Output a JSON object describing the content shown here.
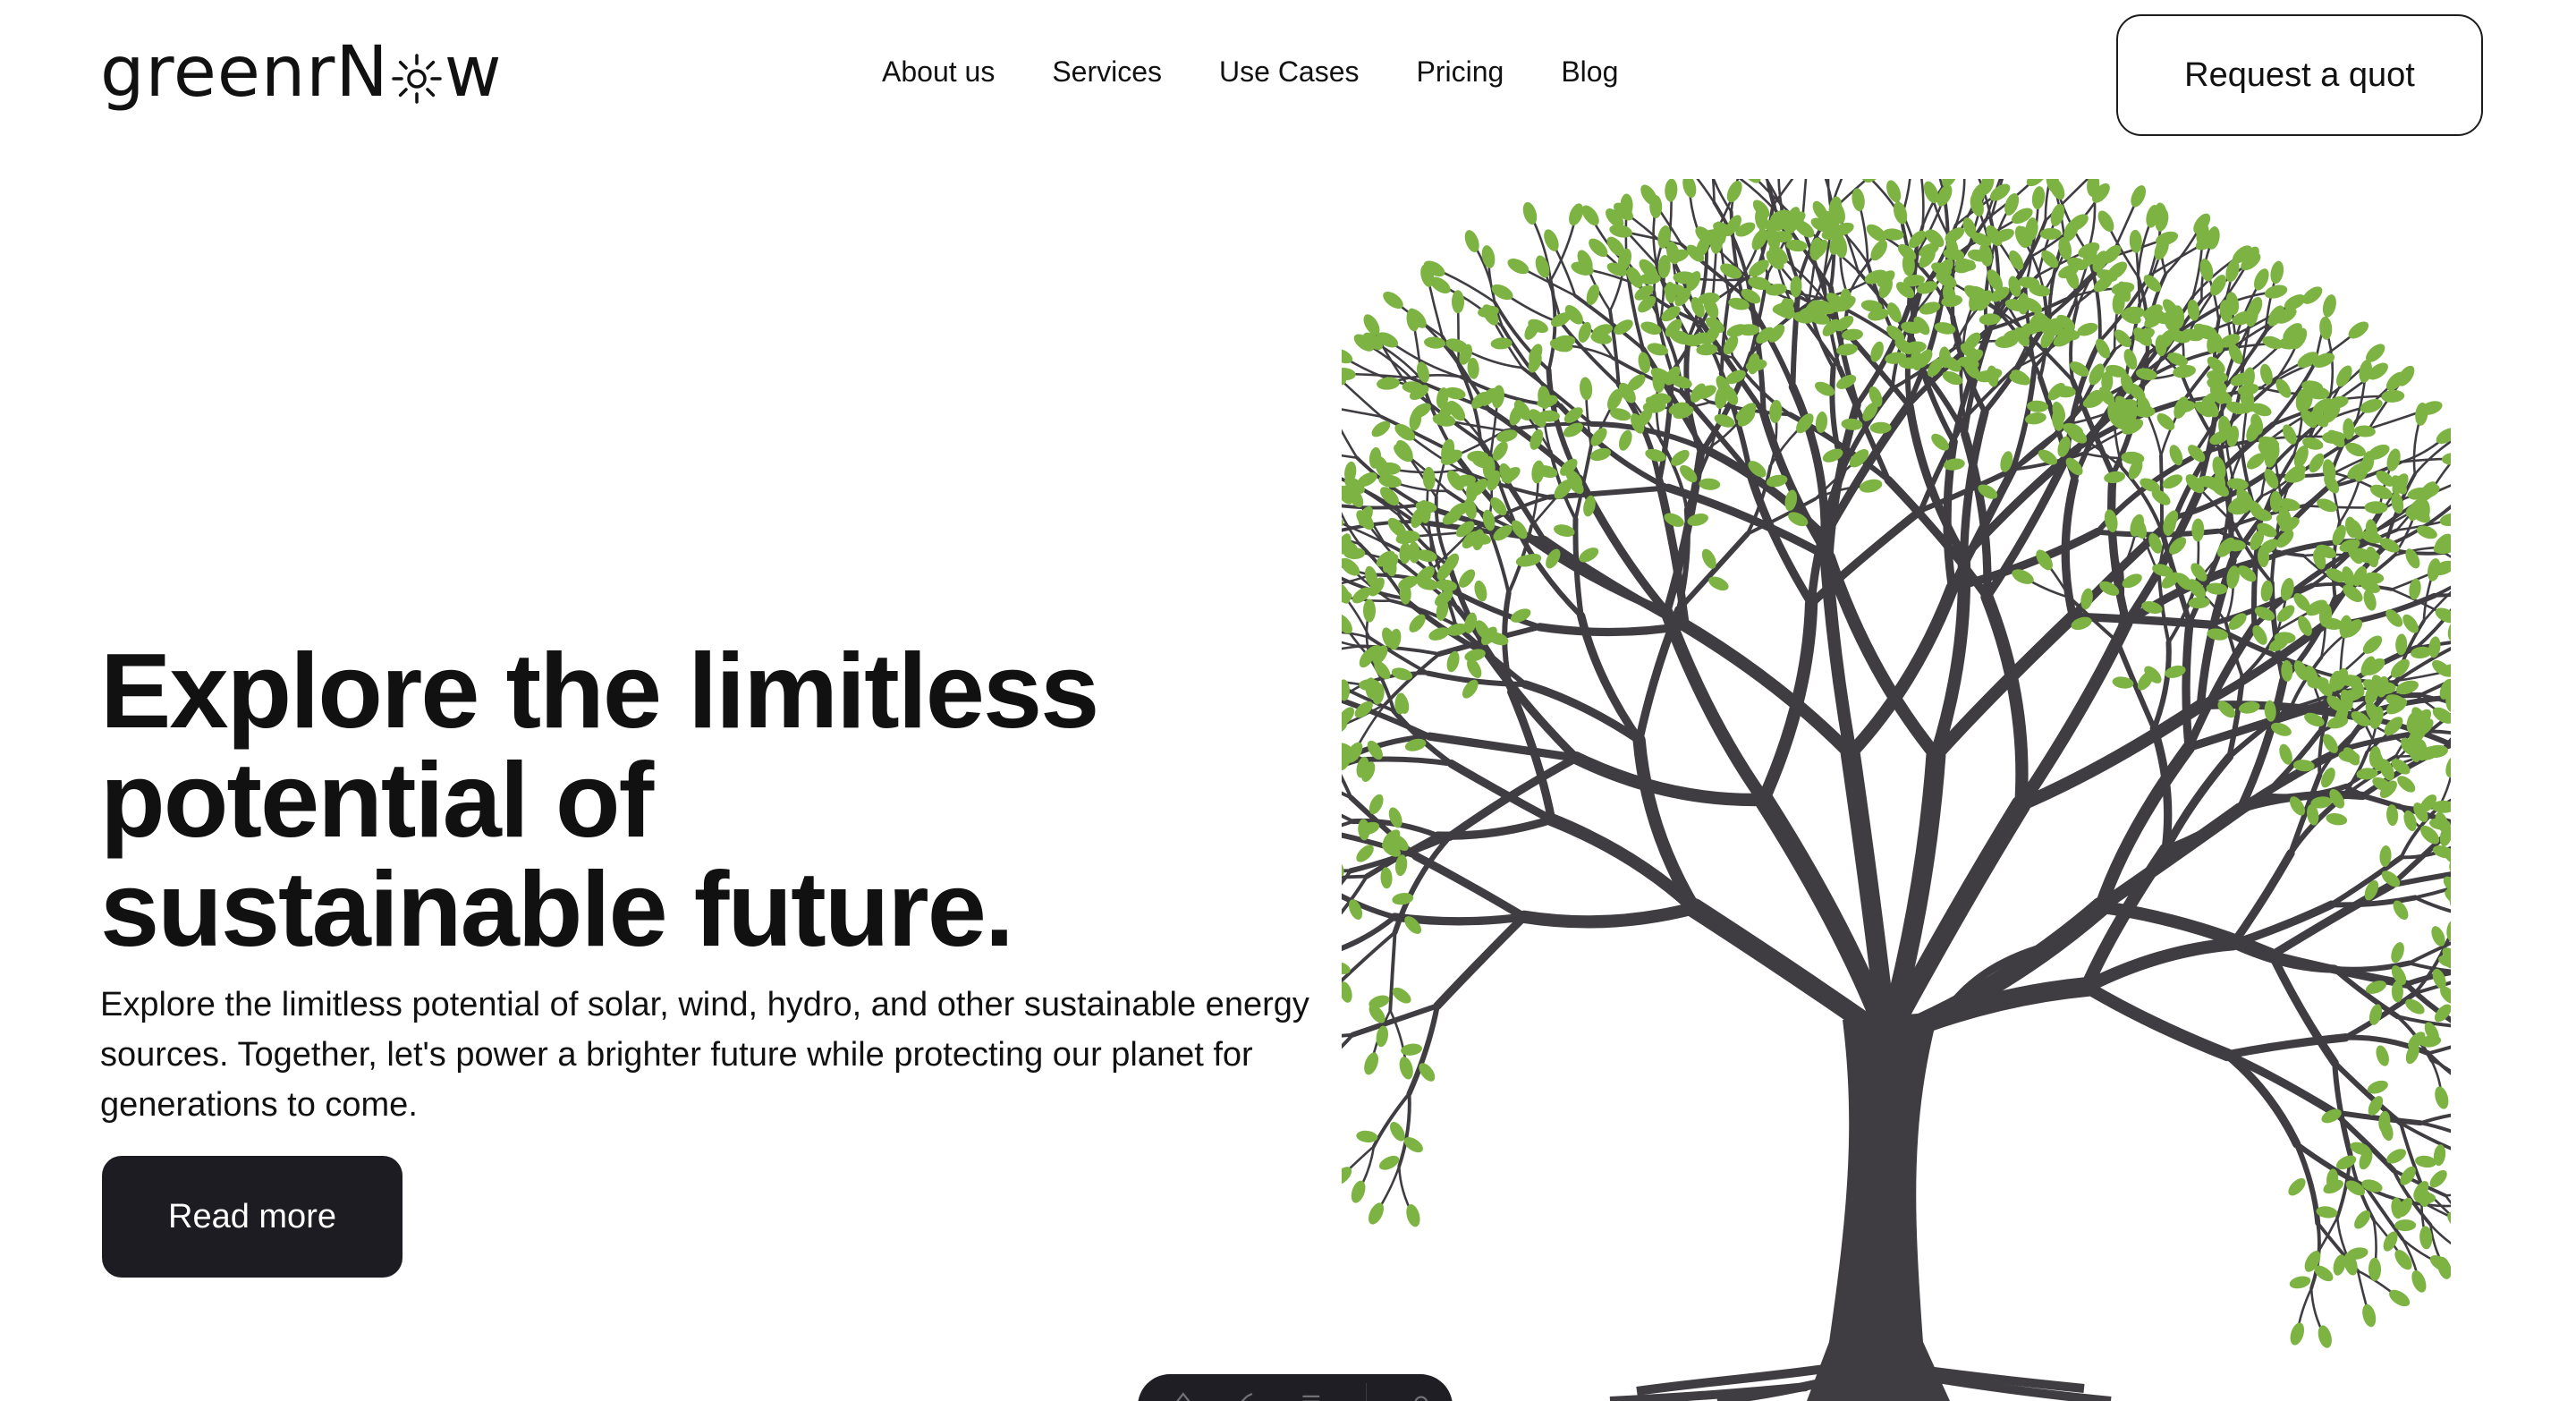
{
  "brand": {
    "name_prefix": "greenrN",
    "name_suffix": "w",
    "logo_icon": "sun-icon"
  },
  "nav": {
    "items": [
      {
        "label": "About us"
      },
      {
        "label": "Services"
      },
      {
        "label": "Use Cases"
      },
      {
        "label": "Pricing"
      },
      {
        "label": "Blog"
      }
    ]
  },
  "header": {
    "cta_label": "Request a quot"
  },
  "hero": {
    "title_line1": "Explore the limitless",
    "title_line2": "potential of",
    "title_line3": "sustainable future.",
    "description": "Explore the limitless potential of solar, wind, hydro, and other sustainable energy sources. Together, let's power a brighter future while protecting our planet for generations to come.",
    "button_label": "Read more",
    "illustration": "tree-illustration"
  },
  "toolbar": {
    "icons": [
      "text-icon",
      "brush-icon",
      "menu-icon",
      "settings-icon"
    ]
  },
  "colors": {
    "leaf": "#7cb342",
    "trunk": "#403d42",
    "button_dark": "#1c1c22",
    "text": "#111111"
  }
}
